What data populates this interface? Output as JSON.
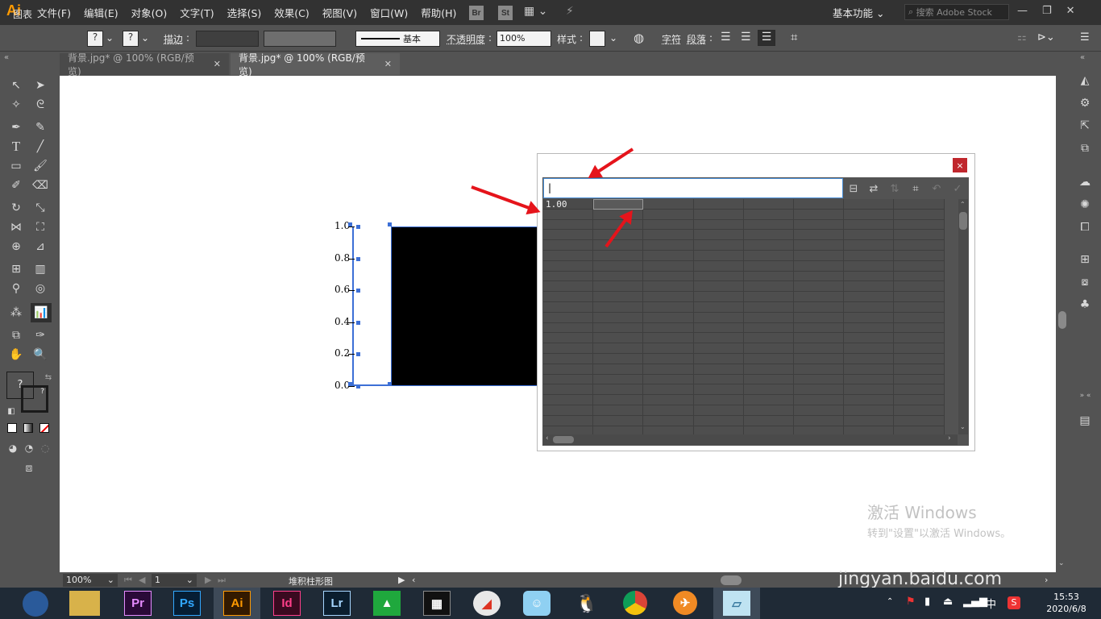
{
  "app": {
    "logo": "Ai"
  },
  "menu": [
    "文件(F)",
    "编辑(E)",
    "对象(O)",
    "文字(T)",
    "选择(S)",
    "效果(C)",
    "视图(V)",
    "窗口(W)",
    "帮助(H)"
  ],
  "bridge_badges": [
    "Br",
    "St"
  ],
  "workspace": "基本功能",
  "stock_search_placeholder": "搜索 Adobe Stock",
  "window_controls": [
    "—",
    "❐",
    "✕"
  ],
  "controlbar": {
    "label": "图表",
    "stroke_label": "描边",
    "stroke_style": "基本",
    "opacity_label": "不透明度",
    "opacity_value": "100%",
    "style_label": "样式",
    "char_label": "字符",
    "para_label": "段落"
  },
  "tabs": [
    {
      "label": "背景.jpg* @ 100% (RGB/预览)",
      "close": "✕"
    },
    {
      "label": "背景.jpg* @ 100% (RGB/预览)",
      "close": "✕"
    }
  ],
  "chart_data": {
    "type": "bar",
    "title": "",
    "xlabel": "",
    "ylabel": "",
    "categories": [
      ""
    ],
    "values": [
      1.0
    ],
    "ylim": [
      0.0,
      1.0
    ],
    "y_ticks": [
      "1.0",
      "0.8",
      "0.6",
      "0.4",
      "0.2",
      "0.0"
    ],
    "bar_color": "#000000",
    "selection_color": "#3c6fd6"
  },
  "dialog": {
    "close": "×",
    "input_value": "|",
    "first_cell": "1.00",
    "columns": 8,
    "rows": 23
  },
  "status": {
    "zoom": "100%",
    "page": "1",
    "chart_type": "堆积柱形图"
  },
  "watermark": {
    "line1": "激活 Windows",
    "line2": "转到\"设置\"以激活 Windows。",
    "site": "jingyan.baidu.com"
  },
  "taskbar": {
    "apps": [
      "Pr",
      "Ps",
      "Ai",
      "Id",
      "Lr"
    ],
    "time": "15:53",
    "date": "2020/6/8",
    "ime": "中"
  }
}
